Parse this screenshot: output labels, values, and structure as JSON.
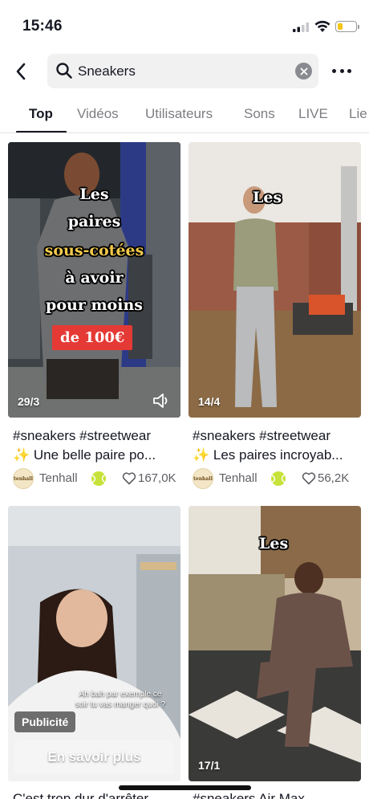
{
  "status_bar": {
    "time": "15:46",
    "battery_level": 0.3,
    "battery_color": "#f5c518"
  },
  "search": {
    "query": "Sneakers"
  },
  "tabs": [
    {
      "label": "Top",
      "active": true
    },
    {
      "label": "Vidéos",
      "active": false
    },
    {
      "label": "Utilisateurs",
      "active": false
    },
    {
      "label": "Sons",
      "active": false
    },
    {
      "label": "LIVE",
      "active": false
    },
    {
      "label": "Lie",
      "active": false
    }
  ],
  "results": [
    {
      "overlay": [
        "Les",
        "paires",
        "sous-cotées",
        "à avoir",
        "pour moins"
      ],
      "price_tag": "de 100€",
      "date": "29/3",
      "caption_line1": "#sneakers #streetwear",
      "caption_line2": "✨ Une belle paire po...",
      "avatar_text": "tenhall",
      "author": "Tenhall",
      "likes": "167,0K"
    },
    {
      "overlay": [
        "Les"
      ],
      "date": "14/4",
      "caption_line1": "#sneakers #streetwear",
      "caption_line2": "✨ Les paires incroyab...",
      "avatar_text": "tenhall",
      "author": "Tenhall",
      "likes": "56,2K"
    },
    {
      "speech": "Ah bah par exemple ce soir tu vas manger quoi ?",
      "ad_label": "Publicité",
      "cta": "En savoir plus",
      "caption_line1": "C'est trop dur d'arrêter"
    },
    {
      "overlay": [
        "Les"
      ],
      "date": "17/1",
      "caption_line1": "#sneakers Air Max"
    }
  ],
  "colors": {
    "accent_red": "#e53935",
    "overlay_yellow": "#f2c94c",
    "text_primary": "#161823",
    "text_secondary": "#7c7d82"
  }
}
